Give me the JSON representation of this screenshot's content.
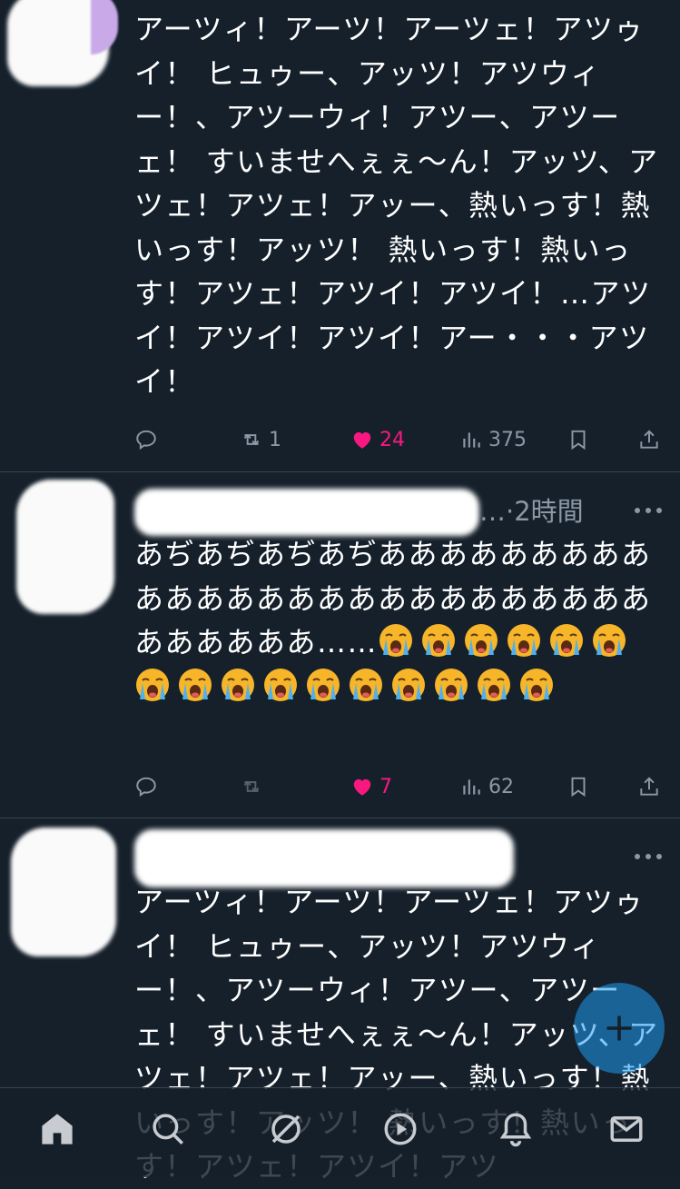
{
  "tweets": [
    {
      "text": "アーツィ！アーツ！アーツェ！アツゥイ！ ヒュゥー、アッツ！アツウィー！、アツーウィ！アツー、アツーェ！ すいませへぇぇ〜ん！アッツ、アツェ！アツェ！アッー、熱いっす！熱いっす！アッツ！ 熱いっす！熱いっす！アツェ！アツイ！アツイ！…アツイ！アツイ！アツイ！アー・・・アツイ！",
      "retweets": "1",
      "likes": "24",
      "views": "375"
    },
    {
      "time": "…·2時間",
      "text": "あぢあぢあぢあぢああああああああああああああああああああああああああああああああ……",
      "emoji_icon": "loudly-crying-face",
      "emoji_count": 16,
      "retweets": "",
      "likes": "7",
      "views": "62"
    },
    {
      "text": "アーツィ！アーツ！アーツェ！アツゥイ！ ヒュゥー、アッツ！アツウィー！、アツーウィ！アツー、アツーェ！ すいませへぇぇ〜ん！アッツ、アツェ！アツェ！アッー、熱いっす！熱いっす！アッツ！ 熱いっす！熱いっす！アツェ！アツイ！アツ"
    }
  ],
  "colors": {
    "background": "#15202b",
    "muted": "#8b98a5",
    "like": "#f91880",
    "accent": "#1d9bf0"
  },
  "icons": [
    "reply-icon",
    "retweet-icon",
    "heart-icon",
    "views-icon",
    "bookmark-icon",
    "share-icon",
    "more-icon",
    "home-icon",
    "search-icon",
    "communities-icon",
    "spaces-icon",
    "notifications-icon",
    "messages-icon",
    "compose-icon"
  ]
}
